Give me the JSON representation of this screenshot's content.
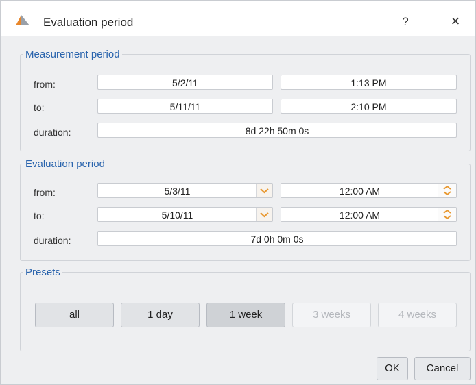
{
  "window": {
    "title": "Evaluation period",
    "help_label": "?",
    "close_label": "×",
    "app_icon": "triangle-logo-icon"
  },
  "measurement": {
    "legend": "Measurement period",
    "from_label": "from:",
    "from_date": "5/2/11",
    "from_time": "1:13 PM",
    "to_label": "to:",
    "to_date": "5/11/11",
    "to_time": "2:10 PM",
    "duration_label": "duration:",
    "duration": "8d 22h 50m 0s"
  },
  "evaluation": {
    "legend": "Evaluation period",
    "from_label": "from:",
    "from_date": "5/3/11",
    "from_time": "12:00 AM",
    "to_label": "to:",
    "to_date": "5/10/11",
    "to_time": "12:00 AM",
    "duration_label": "duration:",
    "duration": "7d 0h 0m 0s"
  },
  "presets": {
    "legend": "Presets",
    "buttons": [
      {
        "label": "all",
        "enabled": true
      },
      {
        "label": "1 day",
        "enabled": true
      },
      {
        "label": "1 week",
        "enabled": true,
        "selected": true
      },
      {
        "label": "3 weeks",
        "enabled": false
      },
      {
        "label": "4 weeks",
        "enabled": false
      }
    ]
  },
  "actions": {
    "ok_label": "OK",
    "cancel_label": "Cancel"
  },
  "colors": {
    "legend_text": "#2a64ad",
    "combo_arrow": "#e8972e",
    "app_icon_orange": "#e8862a",
    "app_icon_gray": "#9aa0a8"
  }
}
